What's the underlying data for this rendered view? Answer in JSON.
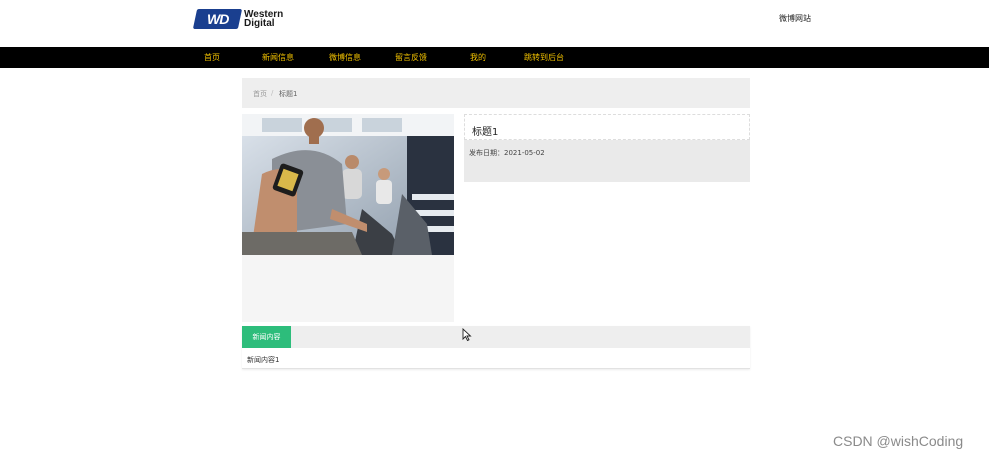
{
  "header": {
    "logo_letters": "WD",
    "logo_line1": "Western",
    "logo_line2": "Digital",
    "site_name": "微博网站"
  },
  "nav": {
    "items": [
      {
        "label": "首页"
      },
      {
        "label": "新闻信息"
      },
      {
        "label": "微博信息"
      },
      {
        "label": "留言反馈"
      },
      {
        "label": "我的"
      },
      {
        "label": "跳转到后台"
      }
    ],
    "text_color": "#f2c200",
    "background": "#000000"
  },
  "breadcrumb": {
    "home": "首页",
    "separator": "/",
    "current": "标题1"
  },
  "article": {
    "title": "标题1",
    "date_text": "发布日期：2021-05-02"
  },
  "content": {
    "tab_label": "新闻内容",
    "text": "新闻内容1",
    "accent_color": "#2dbd7b"
  },
  "watermark": "CSDN @wishCoding"
}
